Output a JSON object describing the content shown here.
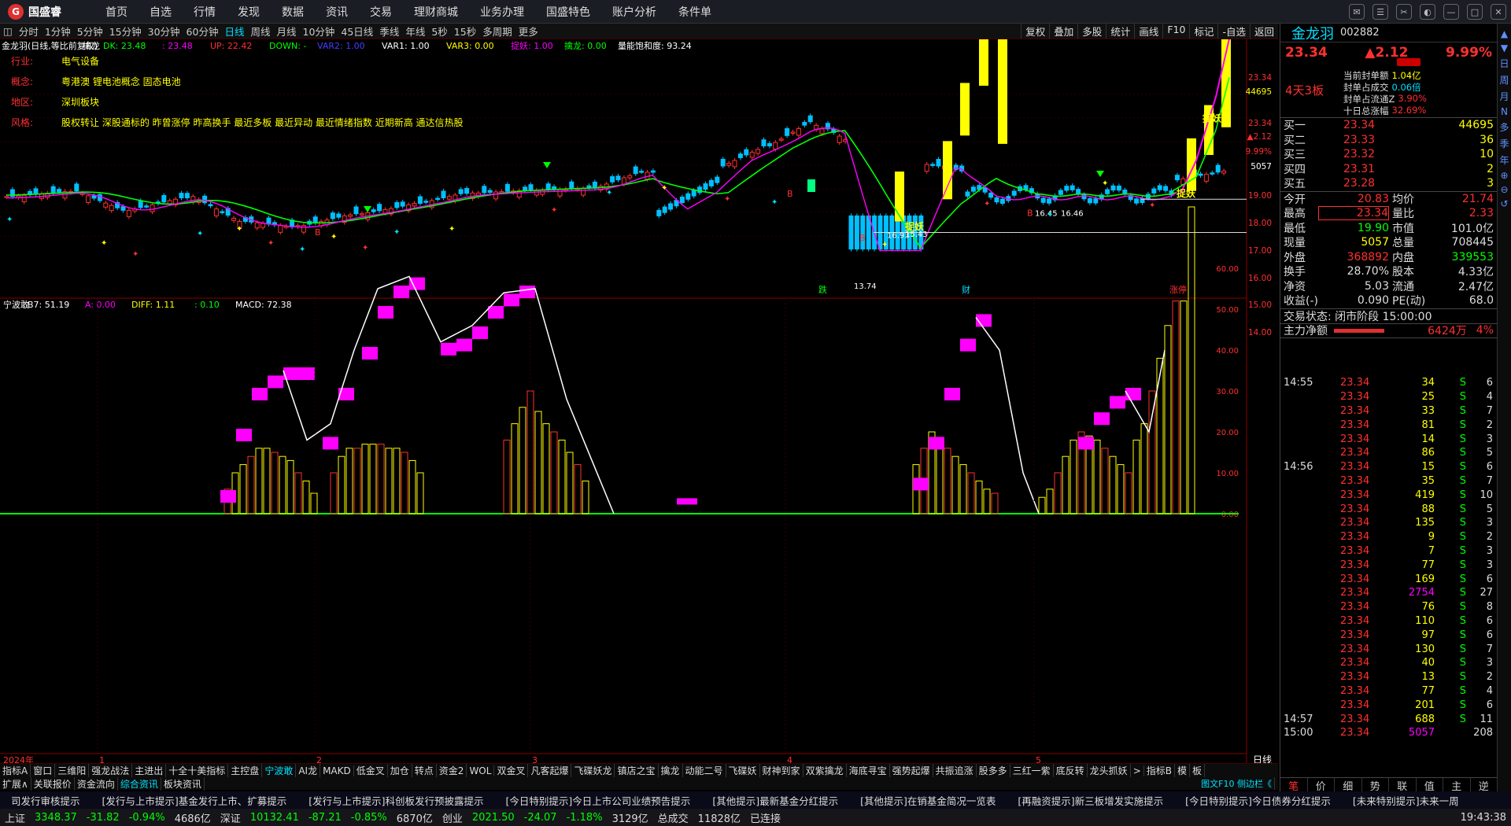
{
  "app": {
    "name": "国盛睿"
  },
  "menu": [
    "首页",
    "自选",
    "行情",
    "发现",
    "数据",
    "资讯",
    "交易",
    "理财商城",
    "业务办理",
    "国盛特色",
    "账户分析",
    "条件单"
  ],
  "periods": [
    "分时",
    "1分钟",
    "5分钟",
    "15分钟",
    "30分钟",
    "60分钟",
    "日线",
    "周线",
    "月线",
    "10分钟",
    "45日线",
    "季线",
    "年线",
    "5秒",
    "15秒",
    "多周期",
    "更多"
  ],
  "period_active": "日线",
  "tools": [
    "复权",
    "叠加",
    "多股",
    "统计",
    "画线",
    "F10",
    "标记",
    "-自选",
    "返回"
  ],
  "indicator1": {
    "name": "金龙羽(日线,等比前复权)",
    "sub": "擒龙",
    "dk": "DK: 23.48",
    "a": ": 23.48",
    "up": "UP: 22.42",
    "down": "DOWN: -",
    "var2": "VAR2: 1.00",
    "var1": "VAR1: 1.00",
    "var3": "VAR3: 0.00",
    "zy": "捉妖: 1.00",
    "ql": "擒龙: 0.00",
    "lh": "量能饱和度: 93.24"
  },
  "info": {
    "l1": "行业:",
    "v1": "电气设备",
    "l2": "概念:",
    "v2": "粤港澳 锂电池概念 固态电池",
    "l3": "地区:",
    "v3": "深圳板块",
    "l4": "风格:",
    "v4": "股权转让 深股通标的 昨曾涨停 昨高换手 最近多板 最近异动 最近情绪指数 近期新高 通达信热股"
  },
  "price_axis": [
    "23.34",
    "44695",
    "23.34",
    "▲2.12",
    "9.99%",
    "5057",
    "19.00",
    "18.00",
    "17.00",
    "16.00",
    "15.00",
    "14.00"
  ],
  "markers": {
    "hi": "23.34",
    "lo": "13.74",
    "p1": "15.43",
    "p2": "16.45",
    "p3": "16.46",
    "p4": "16.93",
    "zy": "捉妖",
    "b": "B",
    "jie": "跌",
    "cai": "财",
    "zt": "涨停"
  },
  "indicator2": {
    "name": "宁波敢",
    "b7": "B7: 51.19",
    "a": "A: 0.00",
    "diff": "DIFF: 1.11",
    "dea": ": 0.10",
    "macd": "MACD: 72.38"
  },
  "macd_axis": [
    "60.00",
    "50.00",
    "40.00",
    "30.00",
    "20.00",
    "10.00",
    "0.00"
  ],
  "dates": {
    "year": "2024年",
    "m1": "1",
    "m2": "2",
    "m3": "3",
    "m4": "4",
    "m5": "5"
  },
  "day_label": "日线",
  "bottom_tabs": [
    "指标A",
    "窗口",
    "三维阳",
    "强龙战法",
    "主进出",
    "十全十美指标",
    "主控盘",
    "宁波敢",
    "AI龙",
    "MAKD",
    "低金叉",
    "加仓",
    "转点",
    "资金2",
    "WOL",
    "双金叉",
    "凡客起爆",
    "飞碟妖龙",
    "镇店之宝",
    "擒龙",
    "动能二号",
    "飞碟妖",
    "财神到家",
    "双紫擒龙",
    "海底寻宝",
    "强势起爆",
    "共振追涨",
    "股多多",
    "三红一紫",
    "底反转",
    "龙头抓妖",
    ">",
    "指标B",
    "模",
    "板"
  ],
  "bottom_tab_active": "宁波敢",
  "ext_tabs": [
    "扩展∧",
    "关联报价",
    "资金流向",
    "综合资讯",
    "板块资讯"
  ],
  "ext_active": "综合资讯",
  "ext_right": "图文F10 侧边栏《",
  "ticker": [
    "司发行审核提示",
    "[发行与上市提示]基金发行上市、扩募提示",
    "[发行与上市提示]科创板发行预披露提示",
    "[今日特别提示]今日上市公司业绩预告提示",
    "[其他提示]最新基金分红提示",
    "[其他提示]在销基金简况一览表",
    "[再融资提示]新三板增发实施提示",
    "[今日特别提示]今日债券分红提示",
    "[未来特别提示]未来一周"
  ],
  "status": {
    "sh_name": "上证",
    "sh": "3348.37",
    "sh_chg": "-31.82",
    "sh_pct": "-0.94%",
    "sh_amt": "4686亿",
    "sz_name": "深证",
    "sz": "10132.41",
    "sz_chg": "-87.21",
    "sz_pct": "-0.85%",
    "sz_amt": "6870亿",
    "cy_name": "创业",
    "cy": "2021.50",
    "cy_chg": "-24.07",
    "cy_pct": "-1.18%",
    "cy_amt": "3129亿",
    "total_name": "总成交",
    "total": "11828亿",
    "conn": "已连接",
    "time": "19:43:38"
  },
  "stock": {
    "name": "金龙羽",
    "code": "002882",
    "price": "23.34",
    "chg": "▲2.12",
    "pct": "9.99%",
    "badge": "4天3板",
    "seal": [
      [
        "当前封单额",
        "1.04亿"
      ],
      [
        "封单占成交",
        "0.06倍"
      ],
      [
        "封单占流通Z",
        "3.90%"
      ],
      [
        "十日总涨幅",
        "32.69%"
      ]
    ],
    "buy": [
      [
        "买一",
        "23.34",
        "44695"
      ],
      [
        "买二",
        "23.33",
        "36"
      ],
      [
        "买三",
        "23.32",
        "10"
      ],
      [
        "买四",
        "23.31",
        "2"
      ],
      [
        "买五",
        "23.28",
        "3"
      ]
    ],
    "stats": [
      [
        "今开",
        "20.83",
        "均价",
        "21.74"
      ],
      [
        "最高",
        "23.34",
        "量比",
        "2.33"
      ],
      [
        "最低",
        "19.90",
        "市值",
        "101.0亿"
      ],
      [
        "现量",
        "5057",
        "总量",
        "708445"
      ],
      [
        "外盘",
        "368892",
        "内盘",
        "339553"
      ],
      [
        "换手",
        "28.70%",
        "股本",
        "4.33亿"
      ],
      [
        "净资",
        "5.03",
        "流通",
        "2.47亿"
      ],
      [
        "收益(-)",
        "0.090",
        "PE(动)",
        "68.0"
      ]
    ],
    "trade_state": "交易状态: 闭市阶段 15:00:00",
    "main_flow": "主力净额",
    "main_flow_val": "6424万",
    "main_flow_pct": "4%",
    "ticks": [
      [
        "14:55",
        "23.34",
        "34",
        "S",
        "6"
      ],
      [
        "",
        "23.34",
        "25",
        "S",
        "4"
      ],
      [
        "",
        "23.34",
        "33",
        "S",
        "7"
      ],
      [
        "",
        "23.34",
        "81",
        "S",
        "2"
      ],
      [
        "",
        "23.34",
        "14",
        "S",
        "3"
      ],
      [
        "",
        "23.34",
        "86",
        "S",
        "5"
      ],
      [
        "14:56",
        "23.34",
        "15",
        "S",
        "6"
      ],
      [
        "",
        "23.34",
        "35",
        "S",
        "7"
      ],
      [
        "",
        "23.34",
        "419",
        "S",
        "10"
      ],
      [
        "",
        "23.34",
        "88",
        "S",
        "5"
      ],
      [
        "",
        "23.34",
        "135",
        "S",
        "3"
      ],
      [
        "",
        "23.34",
        "9",
        "S",
        "2"
      ],
      [
        "",
        "23.34",
        "7",
        "S",
        "3"
      ],
      [
        "",
        "23.34",
        "77",
        "S",
        "3"
      ],
      [
        "",
        "23.34",
        "169",
        "S",
        "6"
      ],
      [
        "",
        "23.34",
        "2754",
        "S",
        "27"
      ],
      [
        "",
        "23.34",
        "76",
        "S",
        "8"
      ],
      [
        "",
        "23.34",
        "110",
        "S",
        "6"
      ],
      [
        "",
        "23.34",
        "97",
        "S",
        "6"
      ],
      [
        "",
        "23.34",
        "130",
        "S",
        "7"
      ],
      [
        "",
        "23.34",
        "40",
        "S",
        "3"
      ],
      [
        "",
        "23.34",
        "13",
        "S",
        "2"
      ],
      [
        "",
        "23.34",
        "77",
        "S",
        "4"
      ],
      [
        "",
        "23.34",
        "201",
        "S",
        "6"
      ],
      [
        "14:57",
        "23.34",
        "688",
        "S",
        "11"
      ],
      [
        "15:00",
        "23.34",
        "5057",
        "",
        "208"
      ]
    ],
    "tabs": [
      "笔",
      "价",
      "细",
      "势",
      "联",
      "值",
      "主",
      "逆"
    ]
  },
  "side_icons": [
    "▲",
    "▼",
    "日",
    "周",
    "月",
    "N",
    "多",
    "季",
    "年",
    "⊕",
    "⊖",
    "↺"
  ]
}
